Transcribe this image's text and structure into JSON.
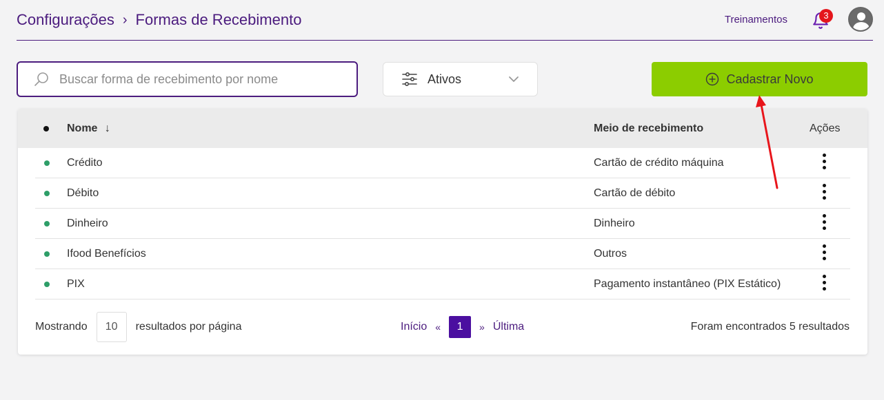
{
  "header": {
    "breadcrumb": [
      "Configurações",
      "Formas de Recebimento"
    ],
    "separator": "›",
    "training_link": "Treinamentos",
    "notification_count": "3"
  },
  "toolbar": {
    "search_placeholder": "Buscar forma de recebimento por nome",
    "filter_label": "Ativos",
    "new_button_label": "Cadastrar Novo"
  },
  "table": {
    "columns": {
      "name": "Nome",
      "sort_indicator": "↓",
      "method": "Meio de recebimento",
      "actions": "Ações"
    },
    "rows": [
      {
        "name": "Crédito",
        "method": "Cartão de crédito máquina"
      },
      {
        "name": "Débito",
        "method": "Cartão de débito"
      },
      {
        "name": "Dinheiro",
        "method": "Dinheiro"
      },
      {
        "name": "Ifood Benefícios",
        "method": "Outros"
      },
      {
        "name": "PIX",
        "method": "Pagamento instantâneo (PIX Estático)"
      }
    ]
  },
  "footer": {
    "showing_label": "Mostrando",
    "per_page_value": "10",
    "per_page_suffix": "resultados por página",
    "first_label": "Início",
    "prev_symbol": "«",
    "current_page": "1",
    "next_symbol": "»",
    "last_label": "Última",
    "result_count": "Foram encontrados 5 resultados"
  },
  "colors": {
    "brand_purple": "#4b1b7e",
    "primary_button": "#8ccd00",
    "active_status": "#2e9e68",
    "badge": "#e4161c",
    "annotation_arrow": "#e8151b"
  }
}
